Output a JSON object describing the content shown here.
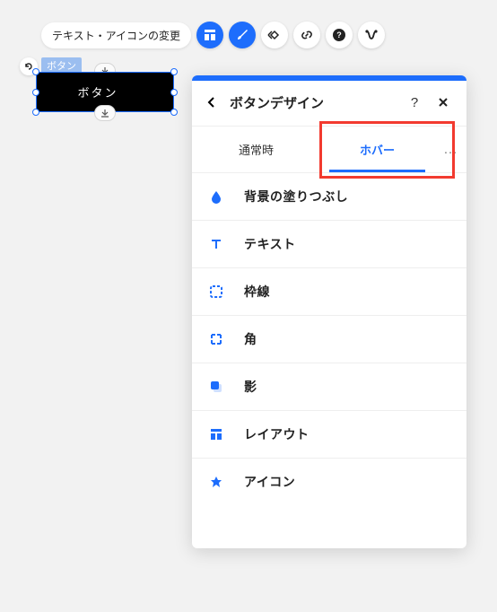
{
  "toolbar": {
    "label": "テキスト・アイコンの変更"
  },
  "element_tag": "ボタン",
  "button": {
    "label": "ボタン"
  },
  "panel": {
    "title": "ボタンデザイン",
    "tabs": {
      "normal": "通常時",
      "hover": "ホバー"
    },
    "sections": {
      "fill": "背景の塗りつぶし",
      "text": "テキスト",
      "border": "枠線",
      "corner": "角",
      "shadow": "影",
      "layout": "レイアウト",
      "icon": "アイコン"
    }
  },
  "help_label": "?",
  "more_label": "…"
}
